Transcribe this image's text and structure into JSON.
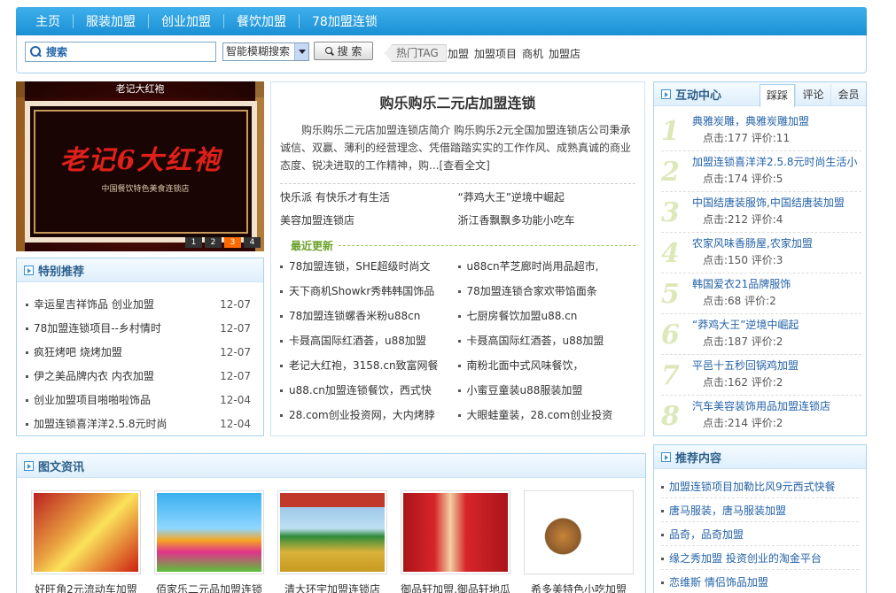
{
  "nav": {
    "items": [
      "主页",
      "服装加盟",
      "创业加盟",
      "餐饮加盟",
      "78加盟连锁"
    ]
  },
  "search": {
    "placeholder": "搜索",
    "mode": "智能模糊搜索",
    "button": "搜 索",
    "hot_label": "热门TAG",
    "tags": [
      "加盟",
      "加盟项目",
      "商机",
      "加盟店"
    ]
  },
  "slide": {
    "caption": "老记大红袍",
    "sign": "老记6大红袍",
    "subsign": "中国餐饮特色美食连锁店",
    "pages": [
      "1",
      "2",
      "3",
      "4"
    ],
    "active_page": "3"
  },
  "special": {
    "title": "特别推荐",
    "items": [
      {
        "t": "幸运星吉祥饰品 创业加盟",
        "d": "12-07"
      },
      {
        "t": "78加盟连锁项目--乡村情时",
        "d": "12-07"
      },
      {
        "t": "疯狂烤吧 烧烤加盟",
        "d": "12-07"
      },
      {
        "t": "伊之美品牌内衣 内衣加盟",
        "d": "12-07"
      },
      {
        "t": "创业加盟项目啪啪啦饰品",
        "d": "12-04"
      },
      {
        "t": "加盟连锁喜洋洋2.5.8元时尚",
        "d": "12-04"
      }
    ]
  },
  "intro": {
    "title": "购乐购乐二元店加盟连锁",
    "desc": "购乐购乐二元店加盟连锁店简介 购乐购乐2元全国加盟连锁店公司秉承诚信、双赢、薄利的经营理念、凭借踏踏实实的工作作风、成熟真诚的商业态度、锐决进取的工作精神，购...[查看全文]",
    "links": [
      "快乐派 有快乐才有生活",
      "“莽鸡大王”逆境中崛起",
      "美容加盟连锁店",
      "浙江香飘飘多功能小吃车"
    ],
    "latest_label": "最近更新",
    "latest": [
      "78加盟连锁，SHE超级时尚文",
      "u88cn芊芝廊时尚用品超市,",
      "天下商机Showkr秀韩韩国饰品",
      "78加盟连锁合家欢带馅面条",
      "78加盟连锁螺香米粉u88cn",
      "七厨房餐饮加盟u88.cn",
      "卡聂高国际红酒荟，u88加盟",
      "卡聂高国际红酒荟，u88加盟",
      "老记大红袍，3158.cn致富网餐",
      "南粉北面中式风味餐饮，",
      "u88.cn加盟连锁餐饮，西式快",
      "小蜜豆童装u88服装加盟",
      "28.com创业投资网，大内烤脖",
      "大眼蛙童装，28.com创业投资"
    ]
  },
  "interact": {
    "title": "互动中心",
    "tabs": [
      "踩踩",
      "评论",
      "会员"
    ],
    "click_label": "点击",
    "comment_label": "评价",
    "items": [
      {
        "n": "1",
        "t": "典雅炭雕，典雅炭雕加盟",
        "s": "点击:177  评价:11"
      },
      {
        "n": "2",
        "t": "加盟连锁喜洋洋2.5.8元时尚生活小",
        "s": "点击:174  评价:5"
      },
      {
        "n": "3",
        "t": "中国结唐装服饰,中国结唐装加盟",
        "s": "点击:212  评价:4"
      },
      {
        "n": "4",
        "t": "农家风味香肠屋,农家加盟",
        "s": "点击:150  评价:3"
      },
      {
        "n": "5",
        "t": "韩国爱衣21品牌服饰",
        "s": "点击:68  评价:2"
      },
      {
        "n": "6",
        "t": "“莽鸡大王”逆境中崛起",
        "s": "点击:187  评价:2"
      },
      {
        "n": "7",
        "t": "平邑十五秒回锅鸡加盟",
        "s": "点击:162  评价:2"
      },
      {
        "n": "8",
        "t": "汽车美容装饰用品加盟连锁店",
        "s": "点击:214  评价:2"
      }
    ]
  },
  "pics": {
    "title": "图文资讯",
    "items": [
      "好旺角2元流动车加盟",
      "佰家乐二元品加盟连锁",
      "清大环宇加盟连锁店",
      "御品轩加盟,御品轩地瓜",
      "希多美特色小吃加盟"
    ]
  },
  "recommend": {
    "title": "推荐内容",
    "items": [
      "加盟连锁项目加勒比风9元西式快餐",
      "唐马服装，唐马服装加盟",
      "品奇，品奇加盟",
      "缘之秀加盟 投资创业的淘金平台",
      "恋维斯 情侣饰品加盟"
    ]
  },
  "colors": {
    "nav": "#1a8fd4",
    "border": "#a8d2ee",
    "link": "#2462a8",
    "accent": "#6aa22a",
    "pager_active": "#ff6a00"
  }
}
